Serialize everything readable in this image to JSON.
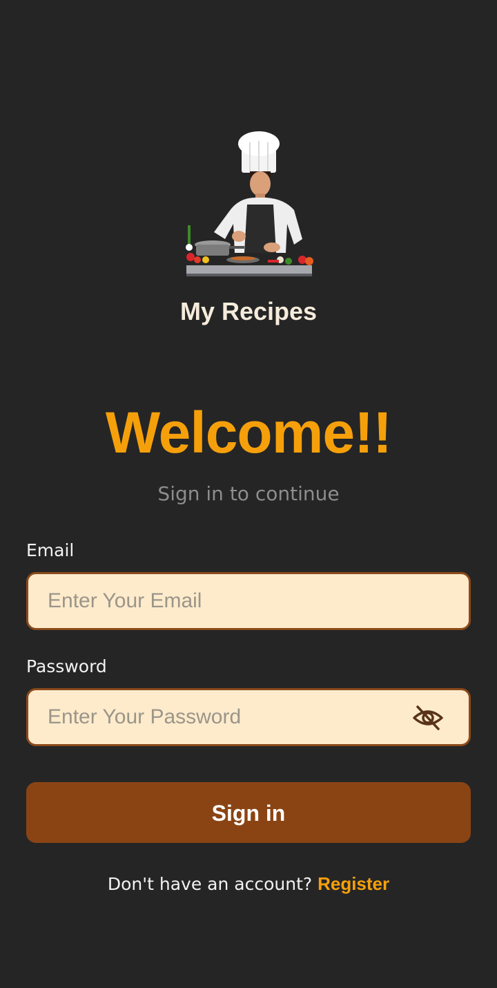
{
  "app": {
    "name": "My Recipes",
    "logo_icon": "chef-cooking-illustration"
  },
  "hero": {
    "welcome": "Welcome!!",
    "subtitle": "Sign in to continue"
  },
  "form": {
    "email": {
      "label": "Email",
      "placeholder": "Enter Your Email",
      "value": ""
    },
    "password": {
      "label": "Password",
      "placeholder": "Enter Your Password",
      "value": "",
      "toggle_icon": "eye-off-icon"
    },
    "submit_label": "Sign in"
  },
  "footer": {
    "prompt": "Don't have an account?",
    "register_label": "Register"
  },
  "colors": {
    "background": "#252525",
    "accent": "#f5a00b",
    "button": "#8a4414",
    "field_bg": "#fdebcc",
    "field_border": "#8b4a1a"
  }
}
